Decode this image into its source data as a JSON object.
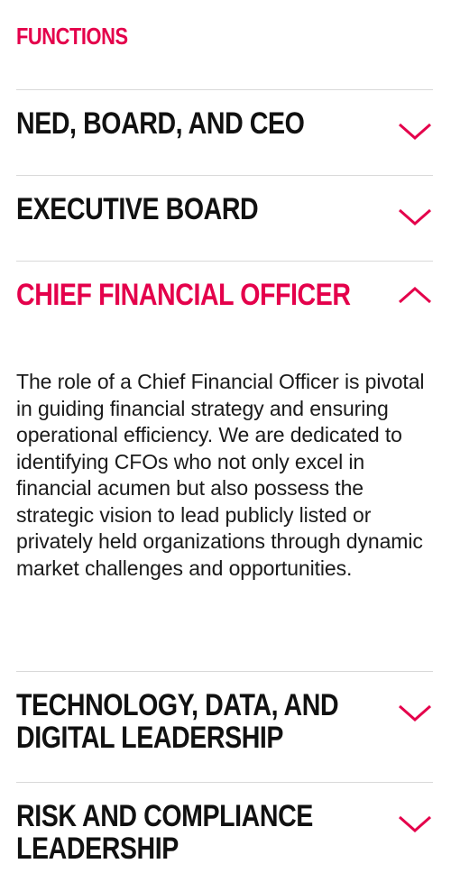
{
  "section": {
    "title": "FUNCTIONS"
  },
  "accordion": {
    "items": [
      {
        "title": "NED, BOARD, AND CEO",
        "expanded": false
      },
      {
        "title": "EXECUTIVE BOARD",
        "expanded": false
      },
      {
        "title": "CHIEF FINANCIAL OFFICER",
        "expanded": true,
        "body": "The role of a Chief Financial Officer is pivotal in guiding financial strategy and ensuring operational efficiency. We are dedicated to identifying CFOs who not only excel in financial acumen but also possess the strategic vision to lead publicly listed or privately held organizations through dynamic market challenges and opportunities."
      },
      {
        "title": "TECHNOLOGY, DATA, AND DIGITAL LEADERSHIP",
        "expanded": false
      },
      {
        "title": "RISK AND COMPLIANCE LEADERSHIP",
        "expanded": false
      }
    ]
  },
  "icons": {
    "collapsed": "chevron-down-icon",
    "expanded": "chevron-up-icon"
  },
  "colors": {
    "accent": "#e4004b",
    "text": "#111111",
    "divider": "#d9d9d9"
  }
}
